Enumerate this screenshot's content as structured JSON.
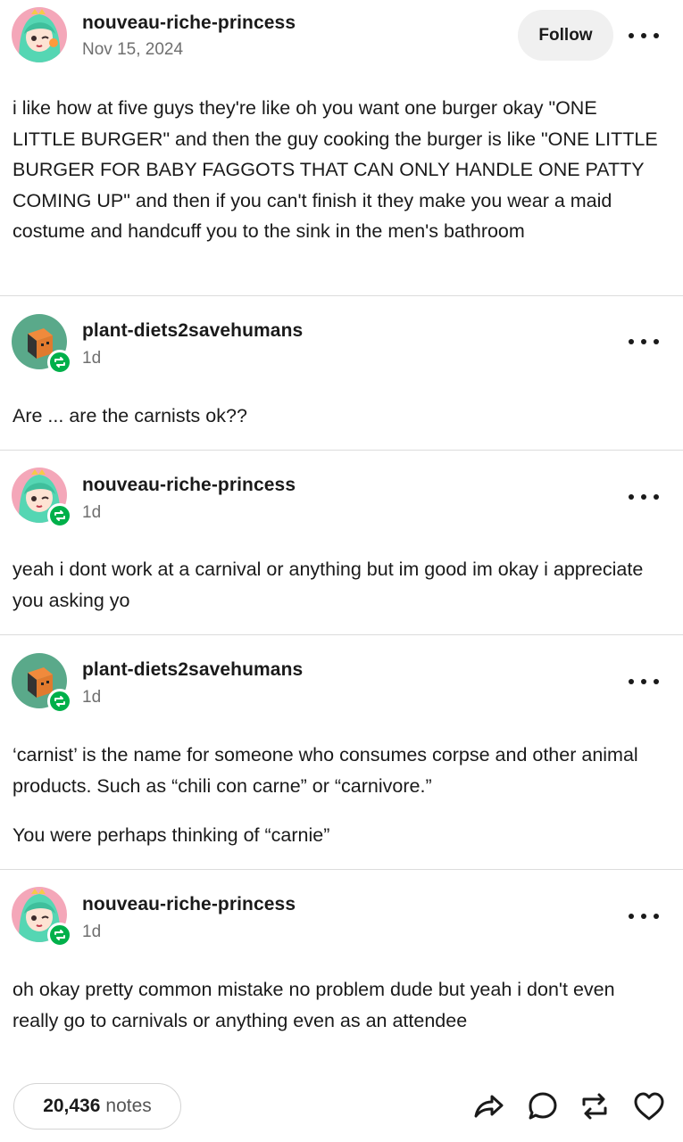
{
  "original_post": {
    "username": "nouveau-riche-princess",
    "date": "Nov 15, 2024",
    "follow_label": "Follow",
    "text": "i like how at five guys they're like oh you want one burger okay \"ONE LITTLE BURGER\" and then the guy cooking the burger is like \"ONE LITTLE BURGER FOR BABY FAGGOTS THAT CAN ONLY HANDLE ONE PATTY COMING UP\" and then if you can't finish it they make you wear a maid costume and handcuff you to the sink in the men's bathroom"
  },
  "reblogs": [
    {
      "username": "plant-diets2savehumans",
      "time": "1d",
      "paragraphs": [
        "Are ... are the carnists ok??"
      ]
    },
    {
      "username": "nouveau-riche-princess",
      "time": "1d",
      "paragraphs": [
        "yeah i dont work at a carnival or anything but im good im okay i appreciate you asking yo"
      ]
    },
    {
      "username": "plant-diets2savehumans",
      "time": "1d",
      "paragraphs": [
        "‘carnist’ is the name for someone who consumes corpse and other animal products. Such as “chili con carne” or “carnivore.”",
        "You were perhaps thinking of “carnie”"
      ]
    },
    {
      "username": "nouveau-riche-princess",
      "time": "1d",
      "paragraphs": [
        "oh okay pretty common mistake no problem dude but yeah i don't even really go to carnivals or anything even as an attendee"
      ]
    }
  ],
  "footer": {
    "notes_count": "20,436",
    "notes_label": "notes"
  },
  "icons": {
    "more": "more-horizontal-icon",
    "share": "share-icon",
    "reply": "reply-icon",
    "reblog": "reblog-icon",
    "like": "heart-icon"
  },
  "colors": {
    "reblog_badge": "#00b04a",
    "divider": "#dcdcdc",
    "follow_bg": "#f0f0f0"
  }
}
